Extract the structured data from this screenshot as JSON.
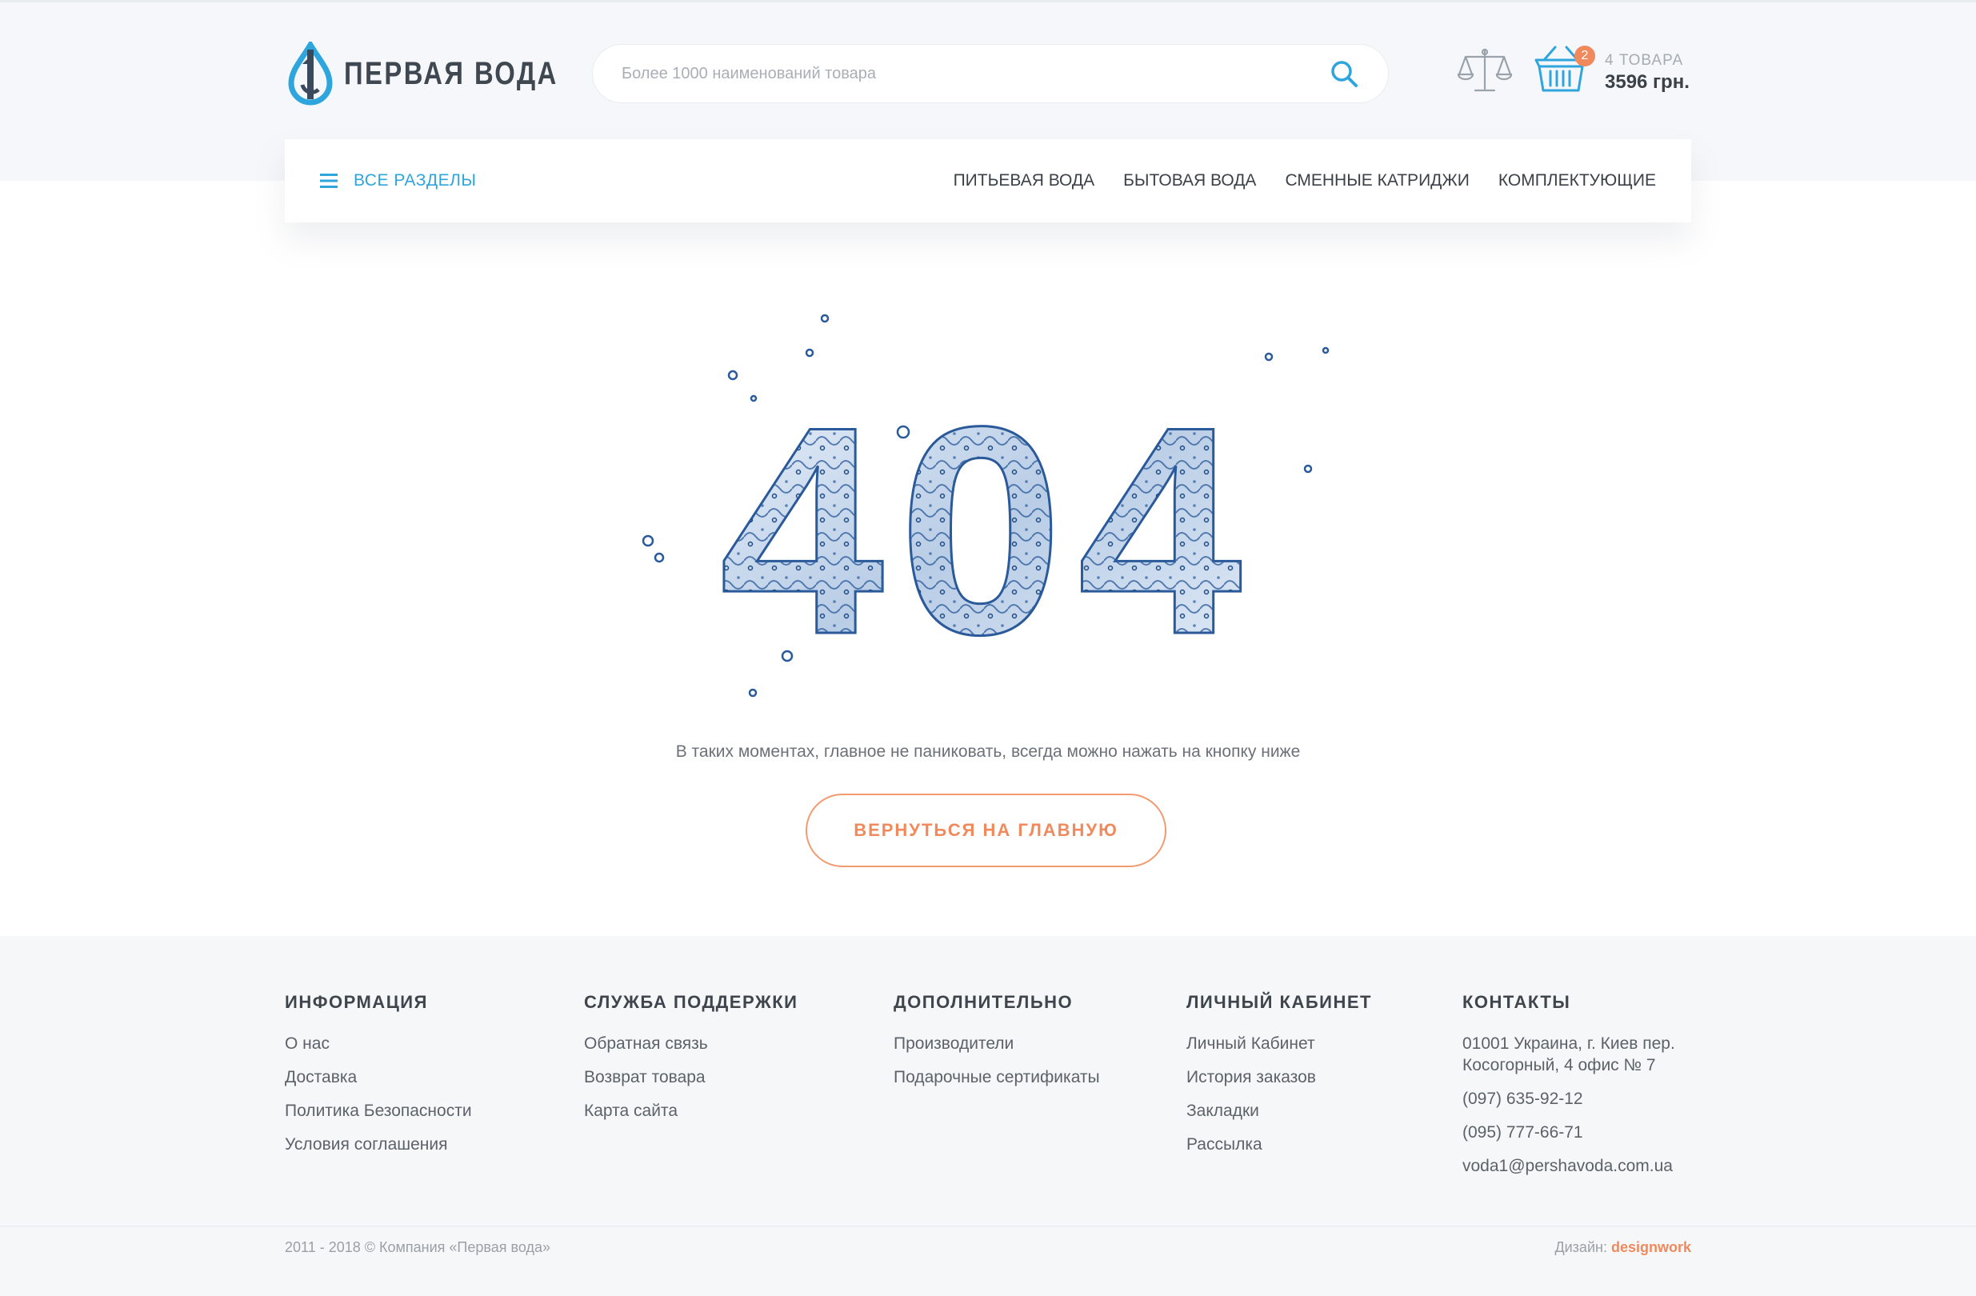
{
  "header": {
    "logo_text": "ПЕРВАЯ ВОДА",
    "search_placeholder": "Более 1000 наименований товара",
    "cart": {
      "badge": "2",
      "count_label": "4 ТОВАРА",
      "total": "3596 грн."
    }
  },
  "nav": {
    "all_sections": "ВСЕ РАЗДЕЛЫ",
    "links": [
      "ПИТЬЕВАЯ ВОДА",
      "БЫТОВАЯ ВОДА",
      "СМЕННЫЕ КАТРИДЖИ",
      "КОМПЛЕКТУЮЩИЕ"
    ]
  },
  "error": {
    "code": "404",
    "message": "В таких моментах, главное не паниковать, всегда можно нажать на кнопку ниже",
    "button_label": "ВЕРНУТЬСЯ НА ГЛАВНУЮ"
  },
  "footer": {
    "info": {
      "title": "ИНФОРМАЦИЯ",
      "links": [
        "О нас",
        "Доставка",
        "Политика Безопасности",
        "Условия соглашения"
      ]
    },
    "support": {
      "title": "СЛУЖБА ПОДДЕРЖКИ",
      "links": [
        "Обратная связь",
        "Возврат товара",
        "Карта сайта"
      ]
    },
    "extra": {
      "title": "ДОПОЛНИТЕЛЬНО",
      "links": [
        "Производители",
        "Подарочные сертификаты"
      ]
    },
    "account": {
      "title": "ЛИЧНЫЙ КАБИНЕТ",
      "links": [
        "Личный Кабинет",
        "История заказов",
        "Закладки",
        "Рассылка"
      ]
    },
    "contacts": {
      "title": "КОНТАКТЫ",
      "address_line1": "01001 Украина, г. Киев пер.",
      "address_line2": "Косогорный, 4 офис № 7",
      "phone1": "(097) 635-92-12",
      "phone2": "(095) 777-66-71",
      "email": "voda1@pershavoda.com.ua"
    },
    "copyright": "2011 - 2018 © Компания «Первая вода»",
    "design_label": "Дизайн:",
    "design_link": "designwork"
  },
  "colors": {
    "accent_blue": "#2ea6dd",
    "accent_orange": "#f08a5d",
    "water_blue": "#2a5a9a",
    "footer_bg": "#f6f7f9",
    "header_bg": "#f5f7fa"
  },
  "icons": {
    "logo": "water-drop-logo-icon",
    "search": "search-icon",
    "compare": "scales-icon",
    "cart": "basket-icon",
    "menu": "hamburger-menu-icon"
  }
}
